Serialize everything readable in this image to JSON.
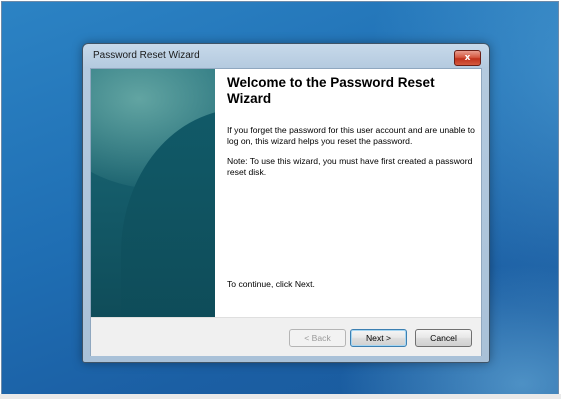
{
  "window": {
    "title": "Password Reset Wizard",
    "close_symbol": "x"
  },
  "content": {
    "heading": "Welcome to the Password Reset Wizard",
    "paragraph1": "If you forget the password for this user account and are unable to log on, this wizard helps you reset the password.",
    "paragraph2": "Note: To use this wizard, you must have first created a password reset disk.",
    "paragraph3": "To continue, click Next."
  },
  "buttons": {
    "back": "< Back",
    "next": "Next >",
    "cancel": "Cancel"
  },
  "colors": {
    "desktop": "#1f6eb3",
    "side_panel": "#135866",
    "close_button": "#c0321c"
  },
  "icons": {
    "close": "close-icon"
  }
}
